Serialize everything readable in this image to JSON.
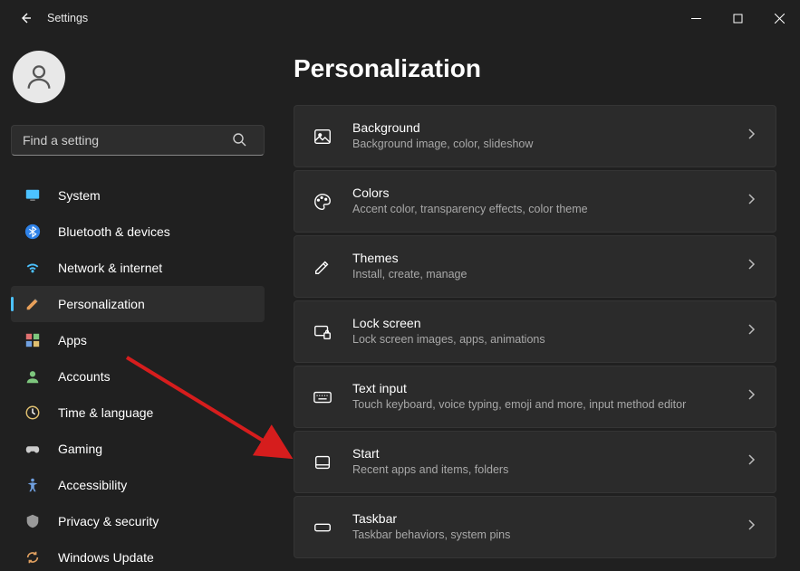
{
  "titlebar": {
    "title": "Settings"
  },
  "search": {
    "placeholder": "Find a setting"
  },
  "nav": [
    {
      "label": "System",
      "icon": "system"
    },
    {
      "label": "Bluetooth & devices",
      "icon": "bluetooth"
    },
    {
      "label": "Network & internet",
      "icon": "network"
    },
    {
      "label": "Personalization",
      "icon": "personalization",
      "selected": true
    },
    {
      "label": "Apps",
      "icon": "apps"
    },
    {
      "label": "Accounts",
      "icon": "accounts"
    },
    {
      "label": "Time & language",
      "icon": "time"
    },
    {
      "label": "Gaming",
      "icon": "gaming"
    },
    {
      "label": "Accessibility",
      "icon": "accessibility"
    },
    {
      "label": "Privacy & security",
      "icon": "privacy"
    },
    {
      "label": "Windows Update",
      "icon": "update"
    }
  ],
  "page": {
    "title": "Personalization"
  },
  "cards": [
    {
      "title": "Background",
      "desc": "Background image, color, slideshow",
      "icon": "background"
    },
    {
      "title": "Colors",
      "desc": "Accent color, transparency effects, color theme",
      "icon": "colors"
    },
    {
      "title": "Themes",
      "desc": "Install, create, manage",
      "icon": "themes"
    },
    {
      "title": "Lock screen",
      "desc": "Lock screen images, apps, animations",
      "icon": "lockscreen"
    },
    {
      "title": "Text input",
      "desc": "Touch keyboard, voice typing, emoji and more, input method editor",
      "icon": "textinput"
    },
    {
      "title": "Start",
      "desc": "Recent apps and items, folders",
      "icon": "start"
    },
    {
      "title": "Taskbar",
      "desc": "Taskbar behaviors, system pins",
      "icon": "taskbar"
    }
  ],
  "colors": {
    "accent": "#4cc2ff",
    "annotation": "#d61d1d"
  }
}
